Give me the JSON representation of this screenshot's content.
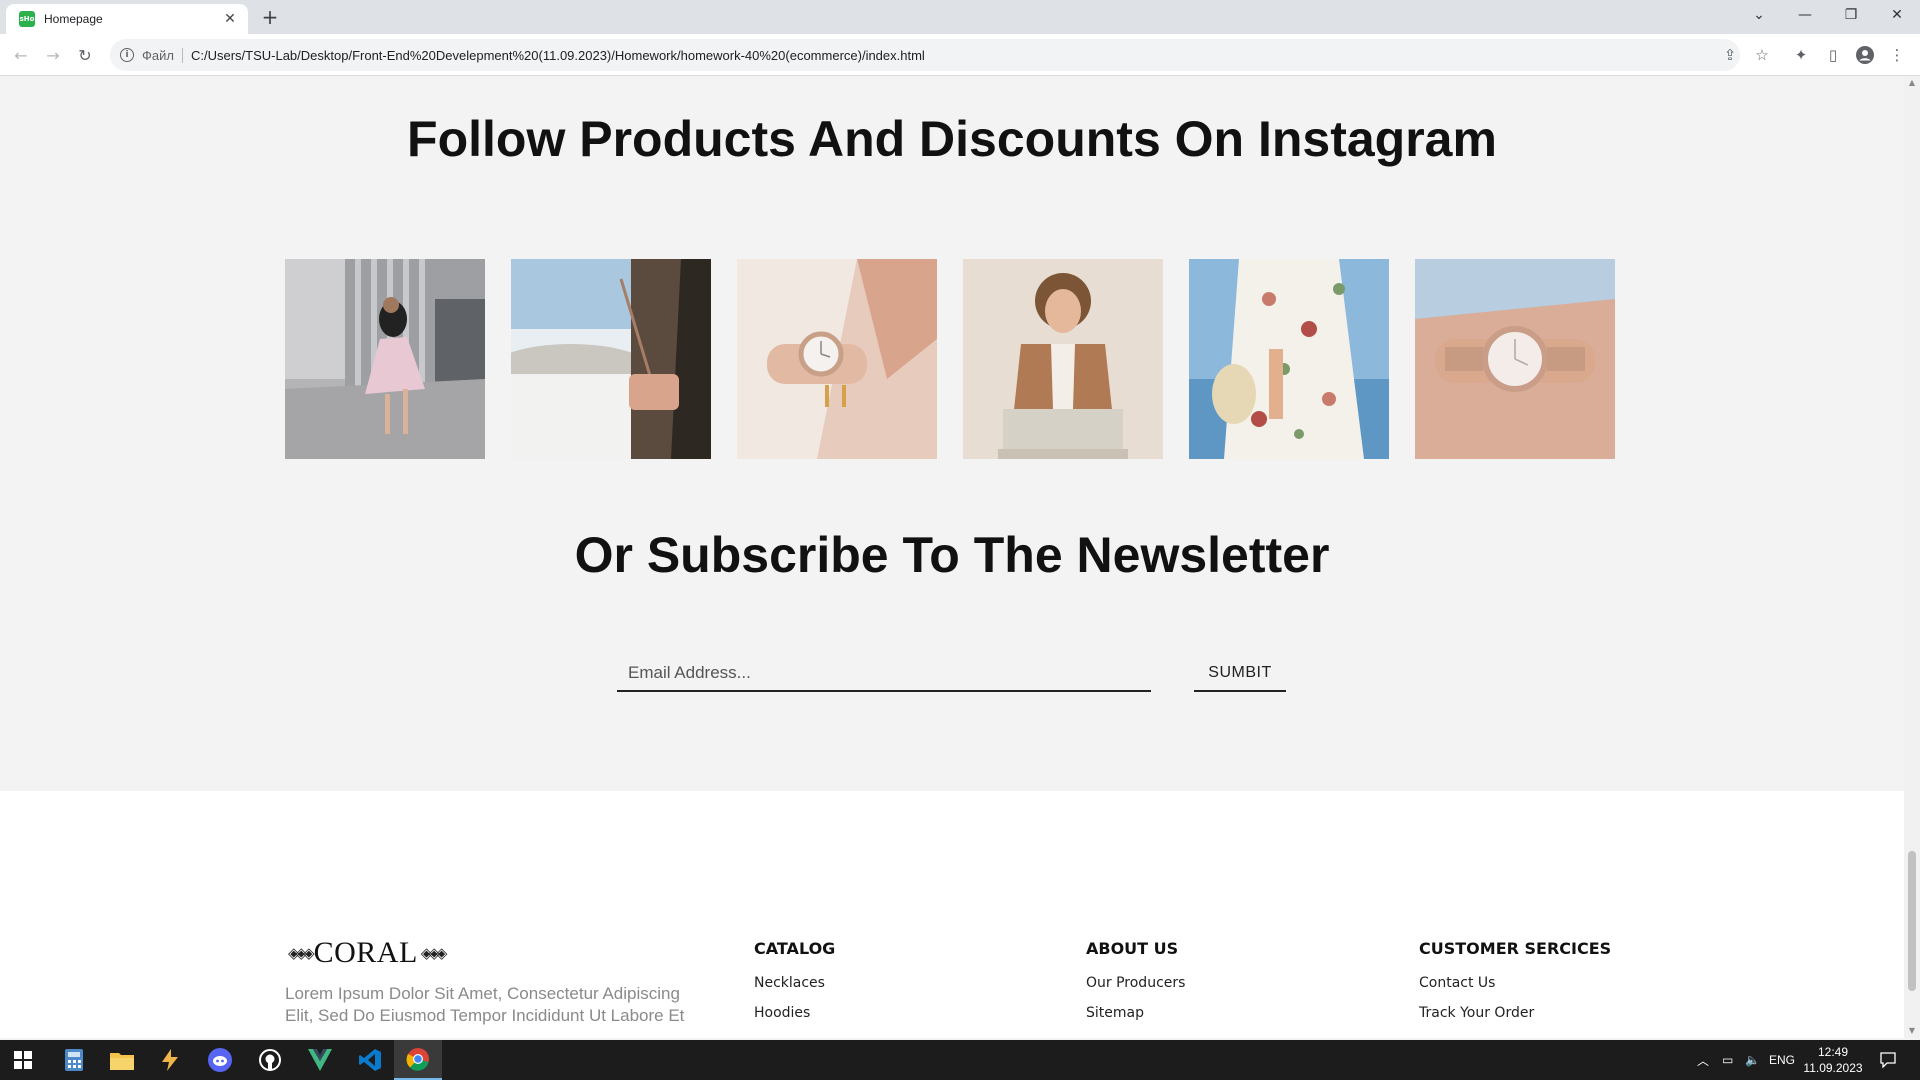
{
  "browser": {
    "tab_title": "Homepage",
    "favicon_text": "sHo",
    "scheme_label": "Файл",
    "url": "C:/Users/TSU-Lab/Desktop/Front-End%20Develepment%20(11.09.2023)/Homework/homework-40%20(ecommerce)/index.html"
  },
  "page": {
    "instagram_title": "Follow Products And Discounts On Instagram",
    "instagram_images": [
      {
        "icon": "woman-jumping-photo"
      },
      {
        "icon": "handbag-snow-photo"
      },
      {
        "icon": "wristwatch-photo"
      },
      {
        "icon": "man-brown-jacket-photo"
      },
      {
        "icon": "floral-dress-photo"
      },
      {
        "icon": "rose-gold-watch-photo"
      }
    ],
    "newsletter_title": "Or Subscribe To The Newsletter",
    "email_placeholder": "Email Address...",
    "submit_label": "SUMBIT"
  },
  "footer": {
    "logo": "CORAL",
    "description": "Lorem Ipsum Dolor Sit Amet, Consectetur Adipiscing Elit, Sed Do Eiusmod Tempor Incididunt Ut Labore Et",
    "columns": [
      {
        "title": "CATALOG",
        "links": [
          "Necklaces",
          "Hoodies"
        ]
      },
      {
        "title": "ABOUT US",
        "links": [
          "Our Producers",
          "Sitemap"
        ]
      },
      {
        "title": "CUSTOMER SERCICES",
        "links": [
          "Contact Us",
          "Track Your Order"
        ]
      }
    ]
  },
  "taskbar": {
    "language": "ENG",
    "time": "12:49",
    "date": "11.09.2023"
  },
  "colors": {
    "page_bg": "#f3f3f3",
    "footer_bg": "#ffffff",
    "taskbar_bg": "#1c1c1c",
    "accent": "#76b9ed"
  }
}
